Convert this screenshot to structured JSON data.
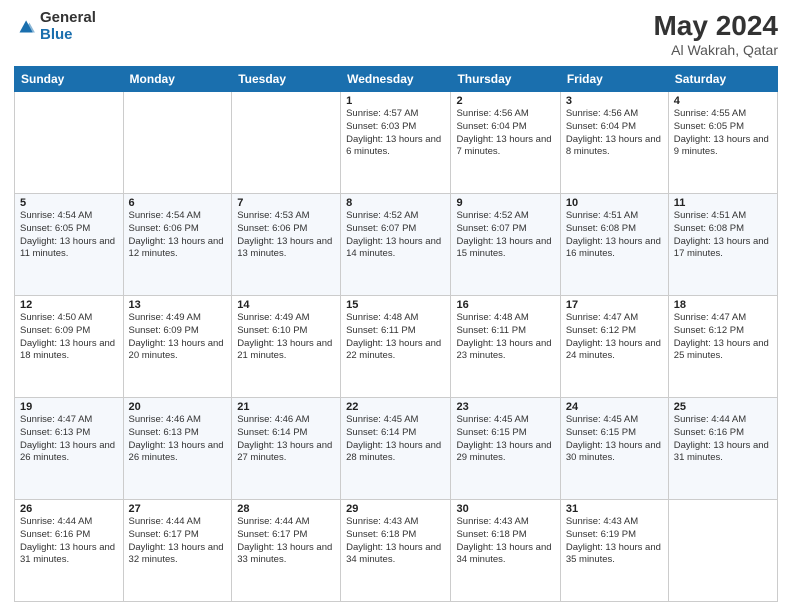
{
  "header": {
    "logo_general": "General",
    "logo_blue": "Blue",
    "title": "May 2024",
    "location": "Al Wakrah, Qatar"
  },
  "days_of_week": [
    "Sunday",
    "Monday",
    "Tuesday",
    "Wednesday",
    "Thursday",
    "Friday",
    "Saturday"
  ],
  "weeks": [
    [
      {
        "date": "",
        "info": ""
      },
      {
        "date": "",
        "info": ""
      },
      {
        "date": "",
        "info": ""
      },
      {
        "date": "1",
        "info": "Sunrise: 4:57 AM\nSunset: 6:03 PM\nDaylight: 13 hours and 6 minutes."
      },
      {
        "date": "2",
        "info": "Sunrise: 4:56 AM\nSunset: 6:04 PM\nDaylight: 13 hours and 7 minutes."
      },
      {
        "date": "3",
        "info": "Sunrise: 4:56 AM\nSunset: 6:04 PM\nDaylight: 13 hours and 8 minutes."
      },
      {
        "date": "4",
        "info": "Sunrise: 4:55 AM\nSunset: 6:05 PM\nDaylight: 13 hours and 9 minutes."
      }
    ],
    [
      {
        "date": "5",
        "info": "Sunrise: 4:54 AM\nSunset: 6:05 PM\nDaylight: 13 hours and 11 minutes."
      },
      {
        "date": "6",
        "info": "Sunrise: 4:54 AM\nSunset: 6:06 PM\nDaylight: 13 hours and 12 minutes."
      },
      {
        "date": "7",
        "info": "Sunrise: 4:53 AM\nSunset: 6:06 PM\nDaylight: 13 hours and 13 minutes."
      },
      {
        "date": "8",
        "info": "Sunrise: 4:52 AM\nSunset: 6:07 PM\nDaylight: 13 hours and 14 minutes."
      },
      {
        "date": "9",
        "info": "Sunrise: 4:52 AM\nSunset: 6:07 PM\nDaylight: 13 hours and 15 minutes."
      },
      {
        "date": "10",
        "info": "Sunrise: 4:51 AM\nSunset: 6:08 PM\nDaylight: 13 hours and 16 minutes."
      },
      {
        "date": "11",
        "info": "Sunrise: 4:51 AM\nSunset: 6:08 PM\nDaylight: 13 hours and 17 minutes."
      }
    ],
    [
      {
        "date": "12",
        "info": "Sunrise: 4:50 AM\nSunset: 6:09 PM\nDaylight: 13 hours and 18 minutes."
      },
      {
        "date": "13",
        "info": "Sunrise: 4:49 AM\nSunset: 6:09 PM\nDaylight: 13 hours and 20 minutes."
      },
      {
        "date": "14",
        "info": "Sunrise: 4:49 AM\nSunset: 6:10 PM\nDaylight: 13 hours and 21 minutes."
      },
      {
        "date": "15",
        "info": "Sunrise: 4:48 AM\nSunset: 6:11 PM\nDaylight: 13 hours and 22 minutes."
      },
      {
        "date": "16",
        "info": "Sunrise: 4:48 AM\nSunset: 6:11 PM\nDaylight: 13 hours and 23 minutes."
      },
      {
        "date": "17",
        "info": "Sunrise: 4:47 AM\nSunset: 6:12 PM\nDaylight: 13 hours and 24 minutes."
      },
      {
        "date": "18",
        "info": "Sunrise: 4:47 AM\nSunset: 6:12 PM\nDaylight: 13 hours and 25 minutes."
      }
    ],
    [
      {
        "date": "19",
        "info": "Sunrise: 4:47 AM\nSunset: 6:13 PM\nDaylight: 13 hours and 26 minutes."
      },
      {
        "date": "20",
        "info": "Sunrise: 4:46 AM\nSunset: 6:13 PM\nDaylight: 13 hours and 26 minutes."
      },
      {
        "date": "21",
        "info": "Sunrise: 4:46 AM\nSunset: 6:14 PM\nDaylight: 13 hours and 27 minutes."
      },
      {
        "date": "22",
        "info": "Sunrise: 4:45 AM\nSunset: 6:14 PM\nDaylight: 13 hours and 28 minutes."
      },
      {
        "date": "23",
        "info": "Sunrise: 4:45 AM\nSunset: 6:15 PM\nDaylight: 13 hours and 29 minutes."
      },
      {
        "date": "24",
        "info": "Sunrise: 4:45 AM\nSunset: 6:15 PM\nDaylight: 13 hours and 30 minutes."
      },
      {
        "date": "25",
        "info": "Sunrise: 4:44 AM\nSunset: 6:16 PM\nDaylight: 13 hours and 31 minutes."
      }
    ],
    [
      {
        "date": "26",
        "info": "Sunrise: 4:44 AM\nSunset: 6:16 PM\nDaylight: 13 hours and 31 minutes."
      },
      {
        "date": "27",
        "info": "Sunrise: 4:44 AM\nSunset: 6:17 PM\nDaylight: 13 hours and 32 minutes."
      },
      {
        "date": "28",
        "info": "Sunrise: 4:44 AM\nSunset: 6:17 PM\nDaylight: 13 hours and 33 minutes."
      },
      {
        "date": "29",
        "info": "Sunrise: 4:43 AM\nSunset: 6:18 PM\nDaylight: 13 hours and 34 minutes."
      },
      {
        "date": "30",
        "info": "Sunrise: 4:43 AM\nSunset: 6:18 PM\nDaylight: 13 hours and 34 minutes."
      },
      {
        "date": "31",
        "info": "Sunrise: 4:43 AM\nSunset: 6:19 PM\nDaylight: 13 hours and 35 minutes."
      },
      {
        "date": "",
        "info": ""
      }
    ]
  ]
}
